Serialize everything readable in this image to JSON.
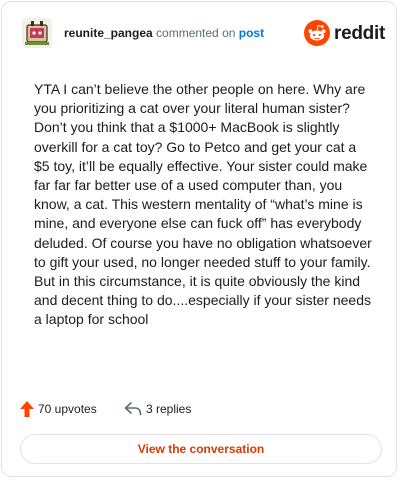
{
  "header": {
    "username": "reunite_pangea",
    "verb": " commented on ",
    "post_link": "post",
    "brand": "reddit"
  },
  "comment": {
    "text": "YTA I can’t believe the other people on here. Why are you prioritizing a cat over your literal human sister? Don’t you think that a $1000+ MacBook is slightly overkill for a cat toy? Go to Petco and get your cat a $5 toy, it’ll be equally effective. Your sister could make far far far better use of a used computer than, you know, a cat. This western mentality of “what’s mine is mine, and everyone else can fuck off” has everybody deluded. Of course you have no obligation whatsoever to gift your used, no longer needed stuff to your family. But in this circumstance, it is quite obviously the kind and decent thing to do....especially if your sister needs a laptop for school"
  },
  "actions": {
    "upvotes": "70 upvotes",
    "replies": "3 replies",
    "upvote_icon": "upvote-arrow-icon",
    "reply_icon": "reply-arrow-icon"
  },
  "cta": {
    "label": "View the conversation"
  },
  "colors": {
    "accent": "#ff4500",
    "cta_text": "#d93a00",
    "link": "#0079d3",
    "muted": "#576f76"
  }
}
